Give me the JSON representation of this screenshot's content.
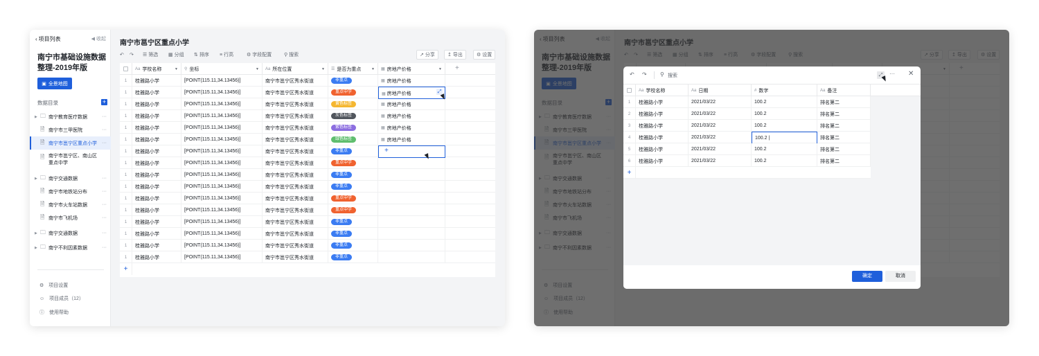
{
  "sidebar": {
    "back_label": "项目列表",
    "collapse_label": "收起",
    "project_title": "南宁市基础设施数据整理-2019年版",
    "map_button": "全景地图",
    "dir_label": "数据目录",
    "items": [
      {
        "label": "南宁教育医疗数据",
        "type": "folder"
      },
      {
        "label": "南宁市三甲医院",
        "type": "file"
      },
      {
        "label": "南宁市邕宁区重点小学",
        "type": "file"
      },
      {
        "label": "南宁市邕宁区、南山区重点中学",
        "type": "file"
      },
      {
        "label": "南宁交通数据",
        "type": "folder"
      },
      {
        "label": "南宁市地铁站分布",
        "type": "file"
      },
      {
        "label": "南宁市火车站数据",
        "type": "file"
      },
      {
        "label": "南宁市飞机场",
        "type": "file"
      },
      {
        "label": "南宁交通数据",
        "type": "folder"
      },
      {
        "label": "南宁不利因素数据",
        "type": "folder"
      }
    ],
    "footer": [
      "项目设置",
      "项目成员（12）",
      "使用帮助"
    ]
  },
  "main": {
    "title": "南宁市邕宁区重点小学",
    "toolbar": {
      "filter": "筛选",
      "group": "分组",
      "sort": "排序",
      "row_height": "行高",
      "field_config": "字段配置",
      "search": "搜索",
      "share": "分享",
      "export": "导出",
      "settings": "设置"
    },
    "columns": [
      "学校名称",
      "坐标",
      "所在位置",
      "是否为重点",
      "房地产价格"
    ],
    "rows": [
      {
        "n": "1",
        "name": "桂雅路小学",
        "coord": "[POINT(115.11,34.13456)]",
        "loc": "南宁市邕宁区秀水街道",
        "tag": "非重点",
        "tag_color": "#3b7cf2",
        "price": "房地产价格"
      },
      {
        "n": "1",
        "name": "桂雅路小学",
        "coord": "[POINT(115.11,34.13456)]",
        "loc": "南宁市邕宁区秀水街道",
        "tag": "重点中学",
        "tag_color": "#f0622f",
        "price": "房地产价格"
      },
      {
        "n": "1",
        "name": "桂雅路小学",
        "coord": "[POINT(115.11,34.13456)]",
        "loc": "南宁市邕宁区秀水街道",
        "tag": "黄色标签",
        "tag_color": "#f5b731",
        "price": "房地产价格"
      },
      {
        "n": "1",
        "name": "桂雅路小学",
        "coord": "[POINT(115.11,34.13456)]",
        "loc": "南宁市邕宁区秀水街道",
        "tag": "灰色标签",
        "tag_color": "#51565d",
        "price": "房地产价格"
      },
      {
        "n": "1",
        "name": "桂雅路小学",
        "coord": "[POINT(115.11,34.13456)]",
        "loc": "南宁市邕宁区秀水街道",
        "tag": "紫色标签",
        "tag_color": "#8c6ee0",
        "price": "房地产价格"
      },
      {
        "n": "1",
        "name": "桂雅路小学",
        "coord": "[POINT(115.11,34.13456)]",
        "loc": "南宁市邕宁区秀水街道",
        "tag": "绿色标签",
        "tag_color": "#5fbe6e",
        "price": "房地产价格"
      },
      {
        "n": "1",
        "name": "桂雅路小学",
        "coord": "[POINT(115.11,34.13456)]",
        "loc": "南宁市邕宁区秀水街道",
        "tag": "非重点",
        "tag_color": "#3b7cf2",
        "price": ""
      },
      {
        "n": "1",
        "name": "桂雅路小学",
        "coord": "[POINT(115.11,34.13456)]",
        "loc": "南宁市邕宁区秀水街道",
        "tag": "重点中学",
        "tag_color": "#f0622f",
        "price": ""
      },
      {
        "n": "1",
        "name": "桂雅路小学",
        "coord": "[POINT(115.11,34.13456)]",
        "loc": "南宁市邕宁区秀水街道",
        "tag": "非重点",
        "tag_color": "#3b7cf2",
        "price": ""
      },
      {
        "n": "1",
        "name": "桂雅路小学",
        "coord": "[POINT(115.11,34.13456)]",
        "loc": "南宁市邕宁区秀水街道",
        "tag": "非重点",
        "tag_color": "#3b7cf2",
        "price": ""
      },
      {
        "n": "1",
        "name": "桂雅路小学",
        "coord": "[POINT(115.11,34.13456)]",
        "loc": "南宁市邕宁区秀水街道",
        "tag": "重点中学",
        "tag_color": "#f0622f",
        "price": ""
      },
      {
        "n": "1",
        "name": "桂雅路小学",
        "coord": "[POINT(115.11,34.13456)]",
        "loc": "南宁市邕宁区秀水街道",
        "tag": "重点中学",
        "tag_color": "#f0622f",
        "price": ""
      },
      {
        "n": "1",
        "name": "桂雅路小学",
        "coord": "[POINT(115.11,34.13456)]",
        "loc": "南宁市邕宁区秀水街道",
        "tag": "非重点",
        "tag_color": "#3b7cf2",
        "price": ""
      },
      {
        "n": "1",
        "name": "桂雅路小学",
        "coord": "[POINT(115.11,34.13456)]",
        "loc": "南宁市邕宁区秀水街道",
        "tag": "非重点",
        "tag_color": "#3b7cf2",
        "price": ""
      },
      {
        "n": "1",
        "name": "桂雅路小学",
        "coord": "[POINT(115.11,34.13456)]",
        "loc": "南宁市邕宁区秀水街道",
        "tag": "非重点",
        "tag_color": "#3b7cf2",
        "price": ""
      },
      {
        "n": "1",
        "name": "桂雅路小学",
        "coord": "[POINT(115.11,34.13456)]",
        "loc": "南宁市邕宁区秀水街道",
        "tag": "非重点",
        "tag_color": "#3b7cf2",
        "price": ""
      }
    ]
  },
  "modal": {
    "search_placeholder": "搜索",
    "columns": [
      "学校名称",
      "日期",
      "数字",
      "备注"
    ],
    "rows": [
      {
        "n": "1",
        "name": "桂雅路小学",
        "date": "2021/03/22",
        "num": "100.2",
        "note": "排名第二"
      },
      {
        "n": "2",
        "name": "桂雅路小学",
        "date": "2021/03/22",
        "num": "100.2",
        "note": "排名第二"
      },
      {
        "n": "3",
        "name": "桂雅路小学",
        "date": "2021/03/22",
        "num": "100.2",
        "note": "排名第二"
      },
      {
        "n": "4",
        "name": "桂雅路小学",
        "date": "2021/03/22",
        "num": "100.2 |",
        "note": "排名第二"
      },
      {
        "n": "5",
        "name": "桂雅路小学",
        "date": "2021/03/22",
        "num": "100.2",
        "note": "排名第二"
      },
      {
        "n": "6",
        "name": "桂雅路小学",
        "date": "2021/03/22",
        "num": "100.2",
        "note": "排名第二"
      }
    ],
    "ok": "确定",
    "cancel": "取消"
  }
}
